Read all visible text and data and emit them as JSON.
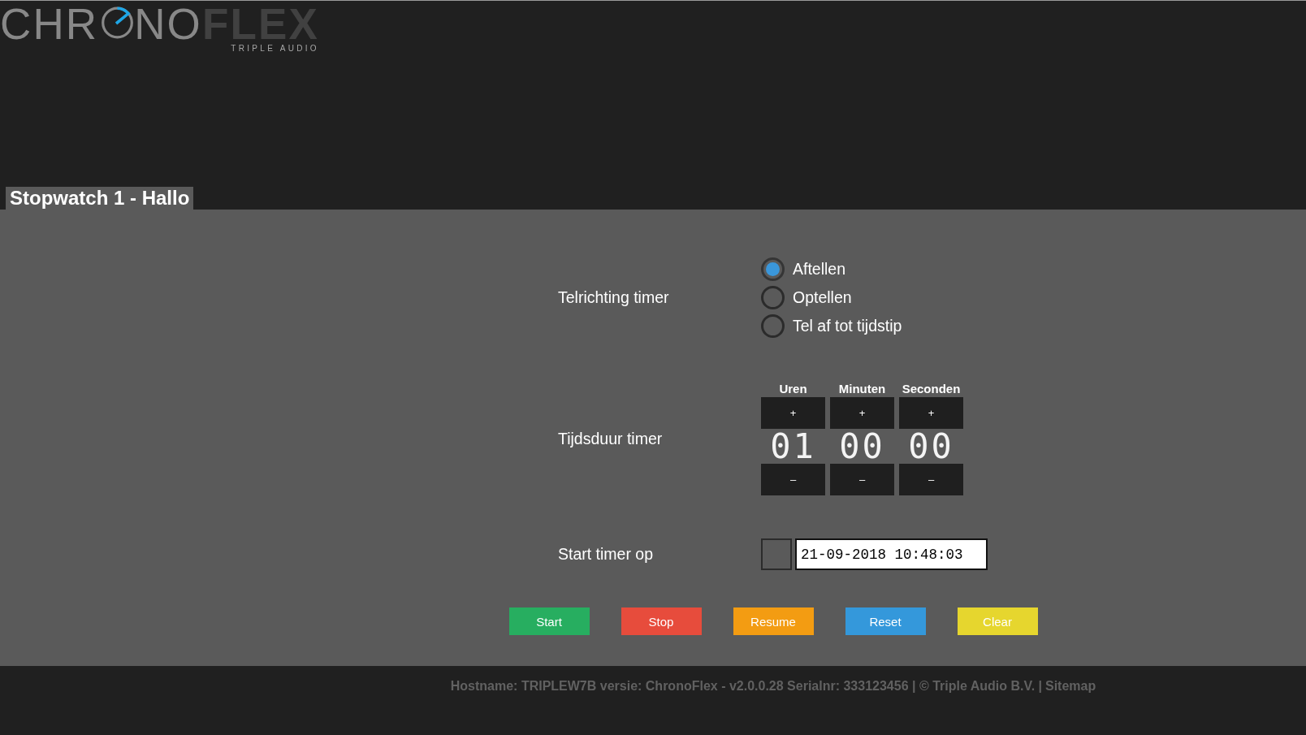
{
  "logo": {
    "light_text_before_dial": "CHR",
    "light_text_after_dial": "NO",
    "bold_text": "FLEX",
    "tagline": "TRIPLE AUDIO"
  },
  "panel_tab": {
    "title": "Stopwatch 1 - Hallo"
  },
  "form": {
    "direction": {
      "label": "Telrichting timer",
      "options": [
        {
          "label": "Aftellen",
          "selected": true
        },
        {
          "label": "Optellen",
          "selected": false
        },
        {
          "label": "Tel af tot tijdstip",
          "selected": false
        }
      ]
    },
    "duration": {
      "label": "Tijdsduur timer",
      "units": [
        {
          "heading": "Uren",
          "increment": "+",
          "value": "01",
          "decrement": "–"
        },
        {
          "heading": "Minuten",
          "increment": "+",
          "value": "00",
          "decrement": "–"
        },
        {
          "heading": "Seconden",
          "increment": "+",
          "value": "00",
          "decrement": "–"
        }
      ]
    },
    "start_at": {
      "label": "Start timer op",
      "checked": false,
      "value": "21-09-2018 10:48:03"
    }
  },
  "buttons": [
    {
      "label": "Start",
      "color": "#27ae60"
    },
    {
      "label": "Stop",
      "color": "#e74c3c"
    },
    {
      "label": "Resume",
      "color": "#f39c12"
    },
    {
      "label": "Reset",
      "color": "#3498db"
    },
    {
      "label": "Clear",
      "color": "#e6d62e"
    }
  ],
  "footer": {
    "info": "Hostname: TRIPLEW7B versie: ChronoFlex - v2.0.0.28 Serialnr: 333123456 | © Triple Audio B.V. |",
    "link": "Sitemap"
  }
}
